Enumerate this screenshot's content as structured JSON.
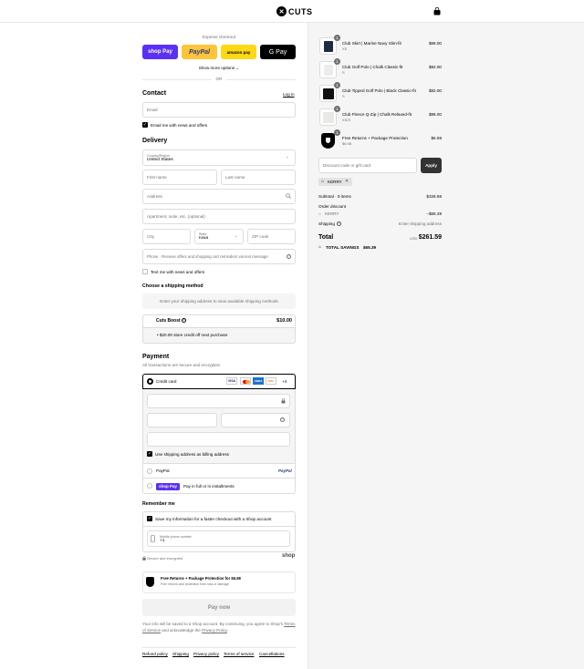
{
  "header": {
    "brand": "CUTS"
  },
  "express": {
    "title": "Express checkout",
    "buttons": [
      "shop Pay",
      "PayPal",
      "amazon pay",
      "G Pay"
    ],
    "show_more": "Show more options",
    "or": "OR"
  },
  "contact": {
    "title": "Contact",
    "login": "Log in",
    "email_placeholder": "Email",
    "news_label": "Email me with news and offers"
  },
  "delivery": {
    "title": "Delivery",
    "country_label": "Country/Region",
    "country_value": "United States",
    "first_name": "First name",
    "last_name": "Last name",
    "address": "Address",
    "apartment": "Apartment, suite, etc. (optional)",
    "city": "City",
    "state_label": "State",
    "state_value": "Iowa",
    "zip": "ZIP code",
    "phone": "Phone · Receive offers and shopping cart reminders via text message",
    "text_label": "Text me with news and offers"
  },
  "shipping": {
    "title": "Choose a shipping method",
    "info": "Enter your shipping address to view available shipping methods",
    "boost_name": "Cuts Boost",
    "boost_price": "$10.00",
    "boost_bullet": "$20.00 store credit off next purchase"
  },
  "payment": {
    "title": "Payment",
    "subtitle": "All transactions are secure and encrypted.",
    "credit_card": "Credit card",
    "card_brands": [
      "VISA",
      "MC",
      "AMEX",
      "DISC"
    ],
    "more_cards": "+4",
    "billing_label": "Use shipping address as billing address",
    "paypal": "PayPal",
    "paypal_logo": "PayPal",
    "shoppay_logo": "shop Pay",
    "shoppay_text": "Pay in full or in installments"
  },
  "remember": {
    "title": "Remember me",
    "save_label": "Save my information for a faster checkout with a Shop account",
    "mobile_label": "Mobile phone number",
    "mobile_value": "+1",
    "secure": "Secure and encrypted",
    "shop": "shop"
  },
  "protection": {
    "title": "Free Returns + Package Protection for $6.98",
    "sub": "Free returns and protection from loss or damage"
  },
  "pay_now": "Pay now",
  "legal": {
    "line1": "Your info will be saved to a Shop account. By continuing, you agree to Shop's",
    "tos": "Terms of Service",
    "mid": " and acknowledge the ",
    "privacy": "Privacy Policy",
    "end": "."
  },
  "footer_links": [
    "Refund policy",
    "Shipping",
    "Privacy policy",
    "Terms of service",
    "Cancellations"
  ],
  "cart": {
    "items": [
      {
        "name": "Club Skirt | Marine Navy Slim-fit",
        "variant": "XS",
        "price": "$68.00",
        "qty": "1"
      },
      {
        "name": "Club Golf Polo | Chalk Classic-fit",
        "variant": "S",
        "price": "$82.00",
        "qty": "1"
      },
      {
        "name": "Club Tipped Golf Polo | Black Classic-fit",
        "variant": "S",
        "price": "$82.00",
        "qty": "1"
      },
      {
        "name": "Club Fleece Q-Zip | Chalk Relaxed-fit",
        "variant": "XS/S",
        "price": "$86.00",
        "qty": "1"
      },
      {
        "name": "Free Returns + Package Protection",
        "variant": "$6.98",
        "price": "$6.98",
        "qty": "1"
      }
    ],
    "discount_placeholder": "Discount code or gift card",
    "apply": "Apply",
    "code": "KERRY",
    "subtotal_label": "Subtotal · 5 items",
    "subtotal": "$326.98",
    "order_discount": "Order discount",
    "discount_code": "KERRY",
    "discount_amount": "−$65.39",
    "shipping_label": "Shipping",
    "shipping_value": "Enter shipping address",
    "total_label": "Total",
    "currency": "USD",
    "total": "$261.59",
    "savings_label": "TOTAL SAVINGS",
    "savings": "$65.39"
  },
  "colors": {
    "shoppay": "#5a31f4",
    "paypal": "#ffc439",
    "amazon": "#ffd814",
    "gpay": "#000000"
  }
}
